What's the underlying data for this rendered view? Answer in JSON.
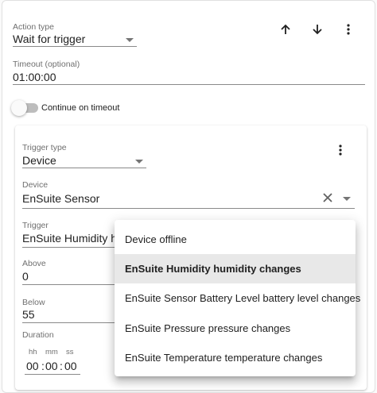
{
  "action": {
    "type_label": "Action type",
    "type_value": "Wait for trigger",
    "timeout_label": "Timeout (optional)",
    "timeout_value": "01:00:00",
    "continue_on_timeout_label": "Continue on timeout",
    "continue_on_timeout_on": false
  },
  "trigger_card": {
    "trigger_type_label": "Trigger type",
    "trigger_type_value": "Device",
    "device_label": "Device",
    "device_value": "EnSuite Sensor",
    "trigger_label": "Trigger",
    "trigger_value": "EnSuite Humidity humidity changes",
    "above_label": "Above",
    "above_value": "0",
    "below_label": "Below",
    "below_value": "55",
    "duration_label": "Duration",
    "duration_units": {
      "hh": "hh",
      "mm": "mm",
      "ss": "ss"
    },
    "duration_values": {
      "hh": "00",
      "mm": "00",
      "ss": "00"
    },
    "duration_sep": ":"
  },
  "trigger_menu": {
    "items": [
      {
        "label": "Device offline",
        "selected": false
      },
      {
        "label": "EnSuite Humidity humidity changes",
        "selected": true
      },
      {
        "label": "EnSuite Sensor Battery Level battery level changes",
        "selected": false
      },
      {
        "label": "EnSuite Pressure pressure changes",
        "selected": false
      },
      {
        "label": "EnSuite Temperature temperature changes",
        "selected": false
      }
    ]
  },
  "icons": {
    "move_up": "arrow-up-icon",
    "move_down": "arrow-down-icon",
    "overflow": "more-vert-icon",
    "clear": "close-icon",
    "dropdown": "caret-down-icon"
  },
  "colors": {
    "text_primary": "#212121",
    "text_secondary": "#6f6f6f",
    "menu_selected_bg": "#e8e8e8",
    "toggle_off_track": "#bdbdbd"
  }
}
